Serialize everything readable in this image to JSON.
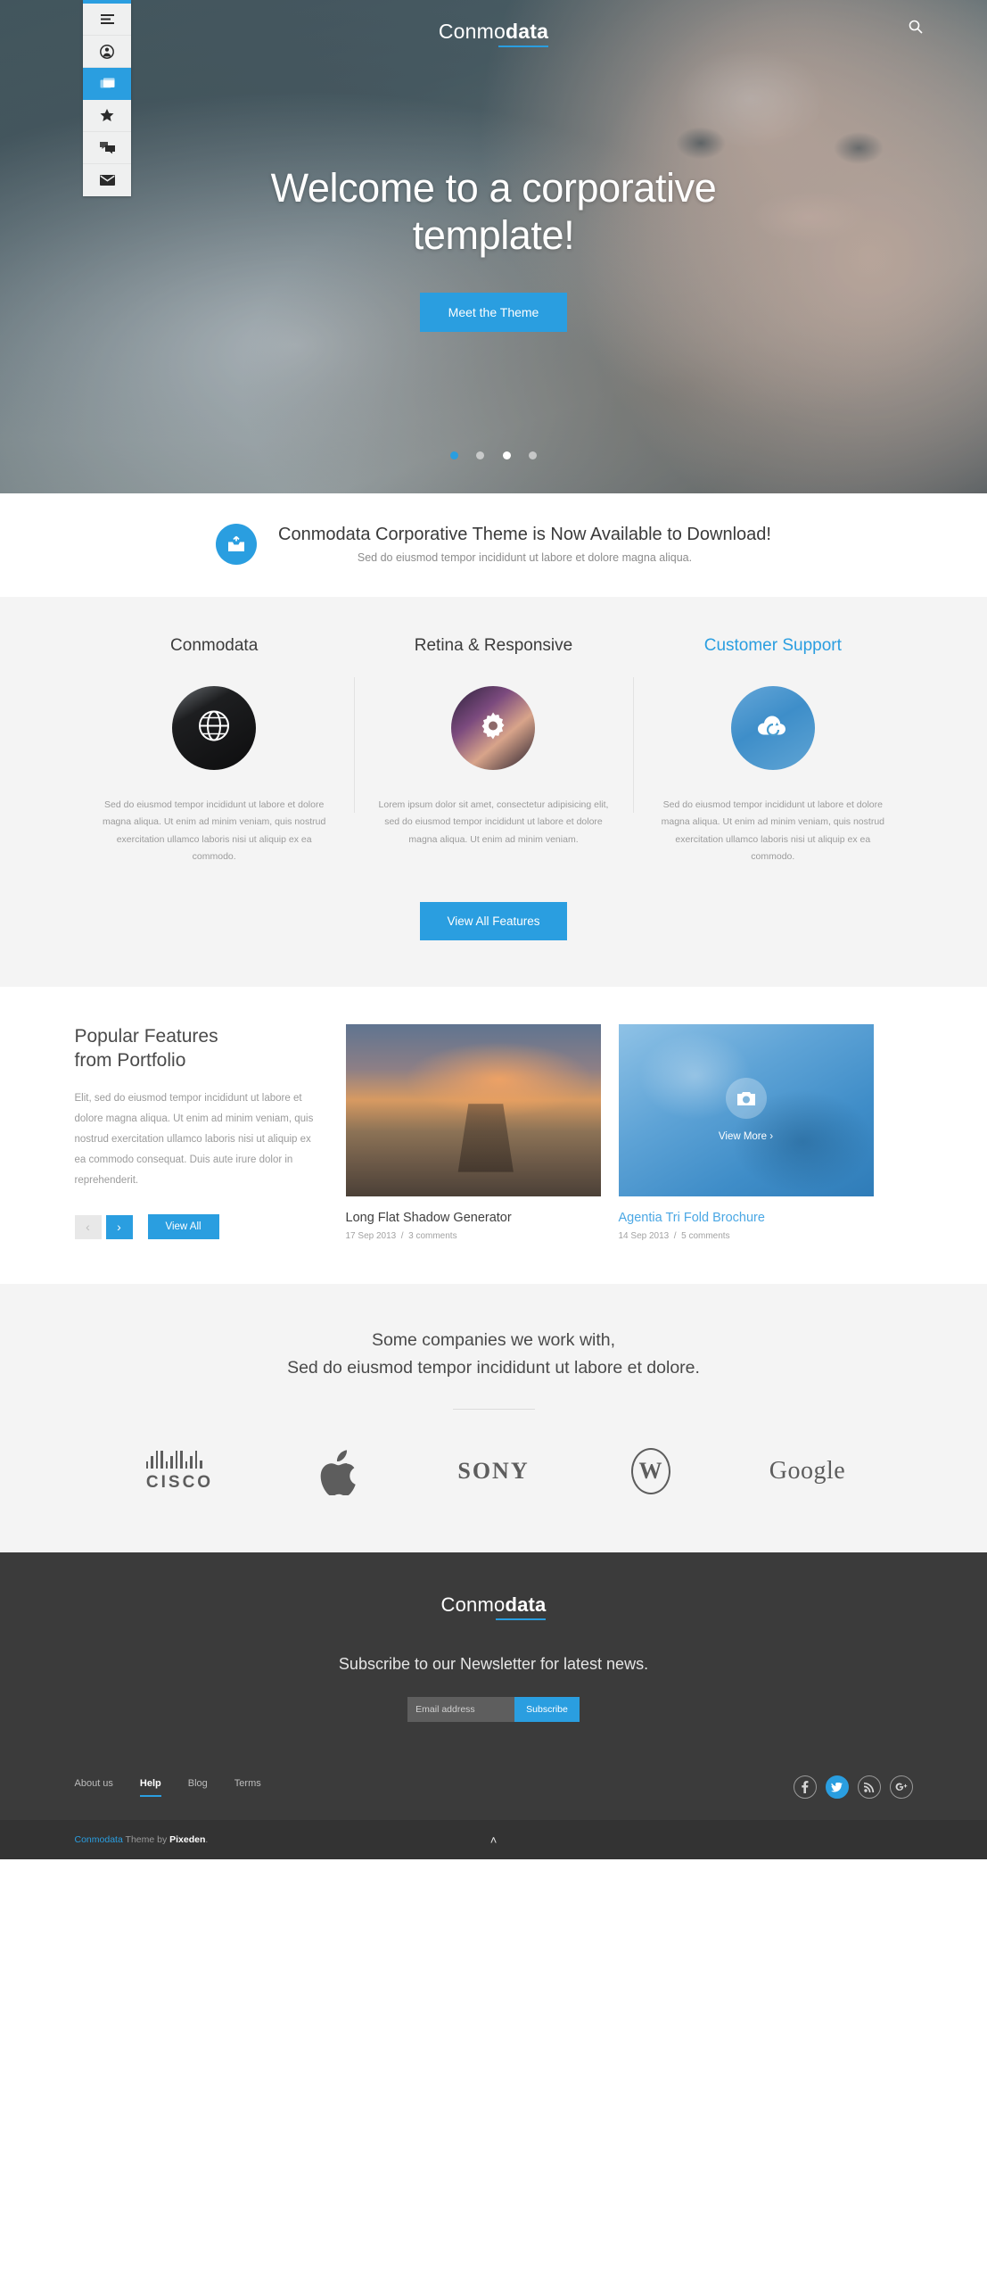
{
  "brand": {
    "light": "Conmo",
    "bold": "data"
  },
  "sidenav": {
    "items": [
      {
        "icon": "list-icon",
        "name": "sidebar-item-menu",
        "active": false
      },
      {
        "icon": "user-icon",
        "name": "sidebar-item-profile",
        "active": false
      },
      {
        "icon": "window-icon",
        "name": "sidebar-item-pages",
        "active": true
      },
      {
        "icon": "star-icon",
        "name": "sidebar-item-features",
        "active": false
      },
      {
        "icon": "chat-icon",
        "name": "sidebar-item-blog",
        "active": false
      },
      {
        "icon": "mail-icon",
        "name": "sidebar-item-contact",
        "active": false
      }
    ]
  },
  "hero": {
    "search_icon": "search-icon",
    "title_line1": "Welcome to a corporative",
    "title_line2": "template!",
    "button": "Meet the Theme",
    "dots": [
      {
        "state": "active"
      },
      {
        "state": "dim"
      },
      {
        "state": "light"
      },
      {
        "state": "dim"
      }
    ]
  },
  "banner": {
    "icon": "inbox-icon",
    "title": "Conmodata Corporative Theme is Now Available to Download!",
    "subtitle": "Sed do eiusmod tempor incididunt ut labore et dolore magna aliqua."
  },
  "features": {
    "columns": [
      {
        "title": "Conmodata",
        "accent": false,
        "thumb_icon": "globe-icon",
        "body": "Sed do eiusmod tempor incididunt ut labore et dolore magna aliqua. Ut enim ad minim veniam, quis nostrud exercitation ullamco laboris nisi ut aliquip ex ea commodo."
      },
      {
        "title": "Retina & Responsive",
        "accent": false,
        "thumb_icon": "gear-icon",
        "body": "Lorem ipsum dolor sit amet, consectetur adipisicing elit, sed do eiusmod tempor incididunt ut labore et dolore magna aliqua. Ut enim ad minim veniam."
      },
      {
        "title": "Customer Support",
        "accent": true,
        "thumb_icon": "refresh-cloud-icon",
        "body": "Sed do eiusmod tempor incididunt ut labore et dolore magna aliqua. Ut enim ad minim veniam, quis nostrud exercitation ullamco laboris nisi ut aliquip ex ea commodo."
      }
    ],
    "cta": "View All Features"
  },
  "portfolio": {
    "heading_line1": "Popular Features",
    "heading_line2": "from Portfolio",
    "body": "Elit, sed do eiusmod tempor incididunt ut labore et dolore magna aliqua. Ut enim ad minim veniam, quis nostrud exercitation ullamco laboris nisi ut aliquip ex ea commodo consequat. Duis aute irure dolor in reprehenderit.",
    "prev_label": "‹",
    "next_label": "›",
    "view_all": "View All",
    "items": [
      {
        "title": "Long Flat Shadow Generator",
        "date": "17 Sep 2013",
        "comments": "3 comments",
        "separator": "/",
        "accent": false,
        "overlay": null
      },
      {
        "title": "Agentia Tri Fold Brochure",
        "date": "14 Sep 2013",
        "comments": "5 comments",
        "separator": "/",
        "accent": true,
        "overlay": {
          "icon": "camera-icon",
          "label": "View More ›"
        }
      }
    ]
  },
  "clients": {
    "heading_line1": "Some companies we work with,",
    "heading_line2": "Sed do eiusmod tempor incididunt ut labore et dolore.",
    "logos": [
      {
        "name": "cisco-logo",
        "text": "CISCO"
      },
      {
        "name": "apple-logo",
        "text": ""
      },
      {
        "name": "sony-logo",
        "text": "SONY"
      },
      {
        "name": "wordpress-logo",
        "text": "W"
      },
      {
        "name": "google-logo",
        "text": "Google"
      }
    ]
  },
  "footer": {
    "newsletter_text": "Subscribe to our Newsletter for latest news.",
    "email_placeholder": "Email address",
    "subscribe_button": "Subscribe",
    "links": [
      {
        "label": "About us",
        "active": false
      },
      {
        "label": "Help",
        "active": true
      },
      {
        "label": "Blog",
        "active": false
      },
      {
        "label": "Terms",
        "active": false
      }
    ],
    "socials": [
      {
        "name": "facebook-icon",
        "glyph": "f",
        "active": false
      },
      {
        "name": "twitter-icon",
        "glyph": "ᴠ",
        "active": true
      },
      {
        "name": "rss-icon",
        "glyph": "))",
        "active": false
      },
      {
        "name": "googleplus-icon",
        "glyph": "g⁺",
        "active": false
      }
    ],
    "copyright_brand": "Conmodata",
    "copyright_mid": " Theme by ",
    "copyright_author": "Pixeden",
    "copyright_end": ".",
    "back_to_top": "˄"
  },
  "colors": {
    "accent": "#2a9ee0",
    "dark": "#3b3b3b",
    "darker": "#333333",
    "muted": "#9b9b9b"
  }
}
